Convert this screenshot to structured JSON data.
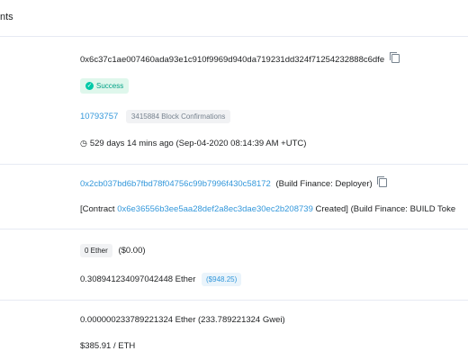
{
  "header": {
    "tab_label": "nts"
  },
  "tx": {
    "hash": "0x6c37c1ae007460ada93e1c910f9969d940da719231dd324f71254232888c6dfe",
    "status": "Success",
    "block": "10793757",
    "confirmations": "3415884 Block Confirmations",
    "timestamp": "529 days 14 mins ago (Sep-04-2020 08:14:39 AM +UTC)",
    "from_address": "0x2cb037bd6b7fbd78f04756c99b7996f430c58172",
    "from_tag": "(Build Finance: Deployer)",
    "to_prefix": "[Contract",
    "to_address": "0x6e36556b3ee5aa28def2a8ec3dae30ec2b208739",
    "to_created": "Created]",
    "to_tag": "(Build Finance: BUILD Toke",
    "value_ether": "0 Ether",
    "value_usd": "($0.00)",
    "fee_ether": "0.308941234097042448 Ether",
    "fee_usd": "($948.25)",
    "gas_price": "0.000000233789221324 Ether (233.789221324 Gwei)",
    "eth_price": "$385.91 / ETH"
  }
}
